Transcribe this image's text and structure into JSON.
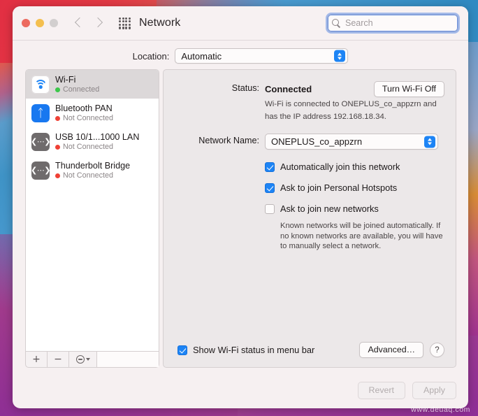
{
  "window": {
    "title": "Network",
    "traffic_lights": [
      "close",
      "minimize",
      "zoom"
    ],
    "back_label": "Back",
    "forward_label": "Forward",
    "grid_label": "Show All"
  },
  "search": {
    "placeholder": "Search",
    "value": ""
  },
  "location": {
    "label": "Location:",
    "value": "Automatic"
  },
  "sidebar": {
    "services": [
      {
        "name": "Wi-Fi",
        "status": "Connected",
        "led": "green",
        "icon": "wifi-icon",
        "selected": true
      },
      {
        "name": "Bluetooth PAN",
        "status": "Not Connected",
        "led": "red",
        "icon": "bluetooth-icon",
        "selected": false
      },
      {
        "name": "USB 10/1...1000 LAN",
        "status": "Not Connected",
        "led": "red",
        "icon": "ethernet-icon",
        "selected": false
      },
      {
        "name": "Thunderbolt Bridge",
        "status": "Not Connected",
        "led": "red",
        "icon": "ethernet-icon",
        "selected": false
      }
    ],
    "toolbar": {
      "add": "+",
      "remove": "−",
      "action": "action-menu"
    }
  },
  "content": {
    "status_label": "Status:",
    "status_value": "Connected",
    "turn_off_button": "Turn Wi-Fi Off",
    "status_description": "Wi-Fi is connected to ONEPLUS_co_appzrn and has the IP address 192.168.18.34.",
    "network_name_label": "Network Name:",
    "network_name_value": "ONEPLUS_co_appzrn",
    "checkboxes": [
      {
        "label": "Automatically join this network",
        "checked": true
      },
      {
        "label": "Ask to join Personal Hotspots",
        "checked": true
      },
      {
        "label": "Ask to join new networks",
        "checked": false
      }
    ],
    "hint": "Known networks will be joined automatically. If no known networks are available, you will have to manually select a network.",
    "menu_bar_checkbox": {
      "label": "Show Wi-Fi status in menu bar",
      "checked": true
    },
    "advanced_button": "Advanced…",
    "help_button": "?"
  },
  "footer": {
    "revert_button": "Revert",
    "apply_button": "Apply"
  },
  "watermark": "www.deuaq.com",
  "colors": {
    "accent_blue": "#1d84f5",
    "status_green": "#3cc74b",
    "status_red": "#ef4136",
    "window_bg": "#f6f0f1",
    "panel_bg": "#ece8e9"
  }
}
